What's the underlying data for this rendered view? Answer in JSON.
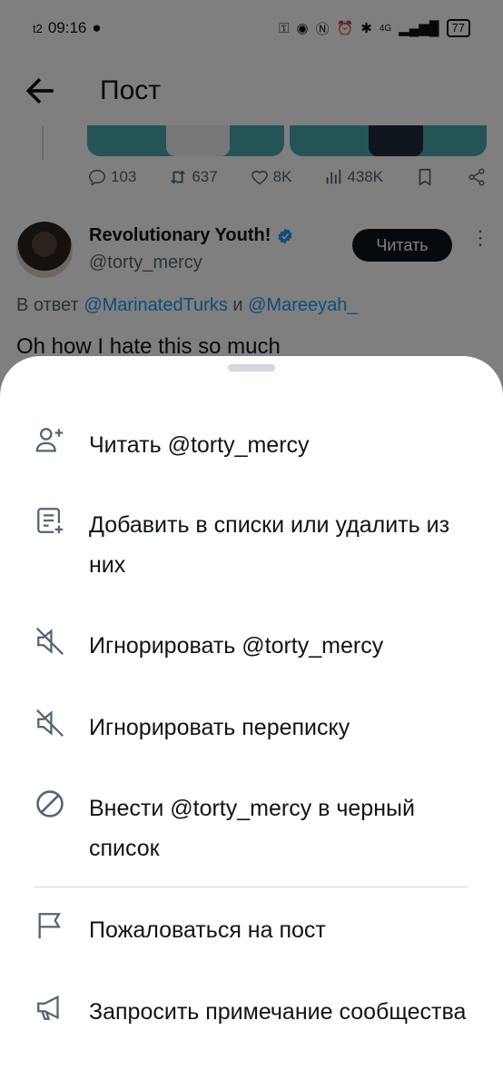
{
  "status_bar": {
    "carrier": "t2",
    "time": "09:16",
    "network": "4G",
    "battery": "77"
  },
  "header": {
    "title": "Пост"
  },
  "post_stats": {
    "replies": "103",
    "reposts": "637",
    "likes": "8K",
    "views": "438K"
  },
  "post": {
    "author_name": "Revolutionary Youth!",
    "handle": "@torty_mercy",
    "follow_label": "Читать",
    "reply_prefix": "В ответ",
    "reply_mention_1": "@MarinatedTurks",
    "reply_and": "и",
    "reply_mention_2": "@Mareeyah_",
    "text": "Oh how I hate this so much"
  },
  "sheet": {
    "items": [
      {
        "label": "Читать @torty_mercy",
        "icon": "follow-user-icon"
      },
      {
        "label": "Добавить в списки или удалить из них",
        "icon": "add-to-list-icon"
      },
      {
        "label": "Игнорировать @torty_mercy",
        "icon": "mute-icon"
      },
      {
        "label": "Игнорировать переписку",
        "icon": "mute-icon"
      },
      {
        "label": "Внести @torty_mercy в черный список",
        "icon": "block-icon"
      },
      {
        "label": "Пожаловаться на пост",
        "icon": "flag-icon"
      },
      {
        "label": "Запросить примечание сообщества",
        "icon": "megaphone-icon"
      }
    ]
  },
  "colors": {
    "accent": "#1d9bf0",
    "text": "#0f1419",
    "secondary": "#536471",
    "icon": "#536471"
  }
}
